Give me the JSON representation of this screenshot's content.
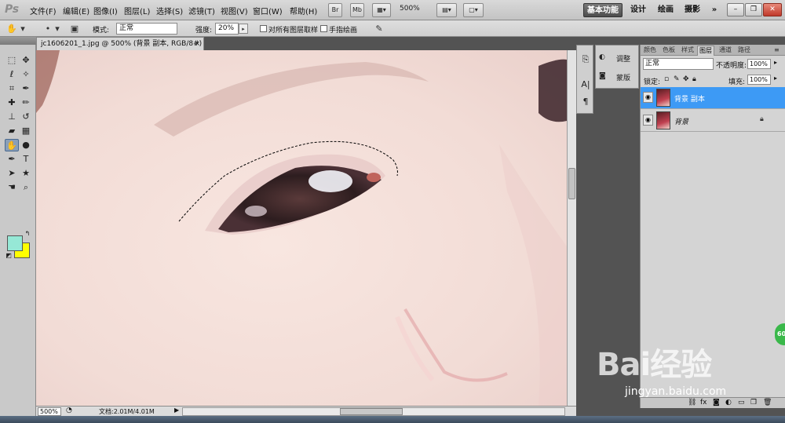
{
  "app": {
    "logo": "Ps"
  },
  "menu": [
    "文件(F)",
    "编辑(E)",
    "图像(I)",
    "图层(L)",
    "选择(S)",
    "滤镜(T)",
    "视图(V)",
    "窗口(W)",
    "帮助(H)"
  ],
  "menubar_buttons": {
    "bridge": "Br",
    "mini_bridge": "Mb",
    "zoom": "500%"
  },
  "workspaces": {
    "essentials": "基本功能",
    "design": "设计",
    "painting": "绘画",
    "photography": "摄影",
    "more": "»"
  },
  "options": {
    "mode_label": "模式:",
    "mode_value": "正常",
    "strength_label": "强度:",
    "strength_value": "20%",
    "sample_all_label": "对所有图层取样",
    "finger_label": "手指绘画"
  },
  "document": {
    "tab_title": "jc1606201_1.jpg @ 500% (背景 副本, RGB/8#) *",
    "close": "×"
  },
  "status": {
    "zoom": "500%",
    "doc_size": "文档:2.01M/4.01M"
  },
  "adjustments": {
    "adjust_label": "调整",
    "masks_label": "蒙版"
  },
  "panel_tabs": [
    "颜色",
    "色板",
    "样式",
    "图层",
    "通道",
    "路径"
  ],
  "active_panel_tab": "图层",
  "layers": {
    "blend_mode": "正常",
    "opacity_label": "不透明度:",
    "opacity_value": "100%",
    "lock_label": "锁定:",
    "fill_label": "填充:",
    "fill_value": "100%",
    "items": [
      {
        "name": "背景 副本",
        "selected": true
      },
      {
        "name": "背景",
        "selected": false
      }
    ]
  },
  "watermark": {
    "brand": "Bai经验",
    "url": "jingyan.baidu.com"
  },
  "badge": "60",
  "colors": {
    "foreground": "#96e8d6",
    "background": "#ffff00",
    "selection": "#3d9af5"
  }
}
